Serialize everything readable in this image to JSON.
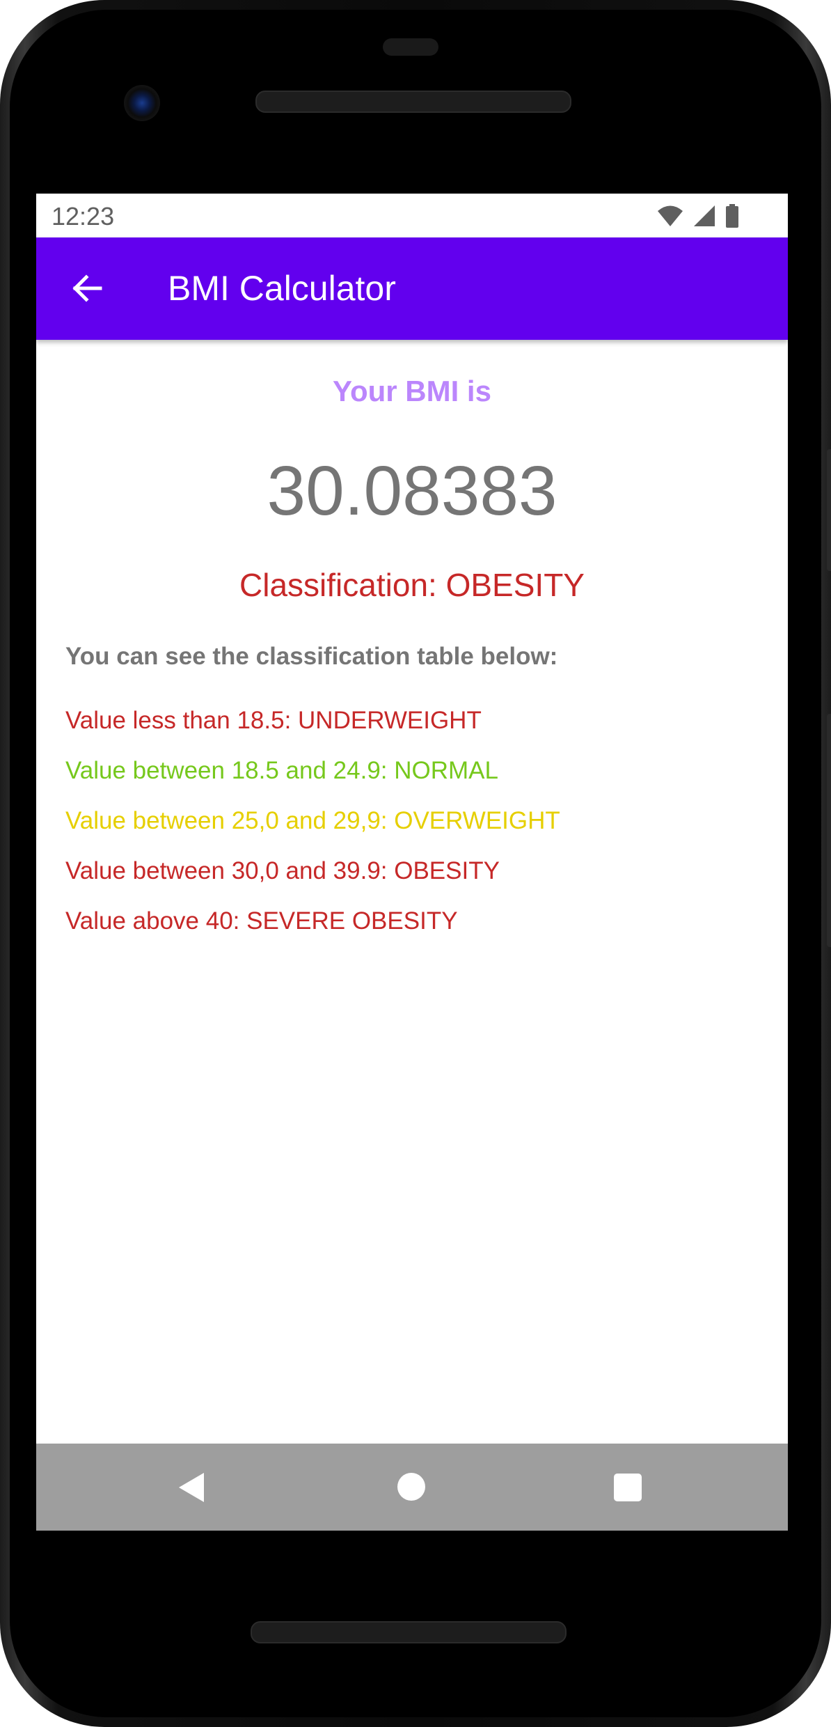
{
  "status_bar": {
    "time": "12:23",
    "icons": [
      "wifi-icon",
      "cellular-signal-icon",
      "battery-icon"
    ]
  },
  "app_bar": {
    "back_icon": "arrow-back-icon",
    "title": "BMI Calculator"
  },
  "result": {
    "heading": "Your BMI is",
    "value": "30.08383",
    "classification": "Classification: OBESITY"
  },
  "table": {
    "intro": "You can see the classification table below:",
    "rows": [
      {
        "text": "Value less than 18.5: UNDERWEIGHT",
        "color": "#c62828"
      },
      {
        "text": "Value between 18.5 and 24.9: NORMAL",
        "color": "#76c81c"
      },
      {
        "text": "Value between 25,0 and 29,9: OVERWEIGHT",
        "color": "#e6cf00"
      },
      {
        "text": "Value between 30,0 and 39.9: OBESITY",
        "color": "#c62828"
      },
      {
        "text": "Value above 40: SEVERE OBESITY",
        "color": "#c62828"
      }
    ]
  },
  "nav_bar": {
    "icons": [
      "nav-back-icon",
      "nav-home-icon",
      "nav-recents-icon"
    ]
  },
  "colors": {
    "app_bar": "#6200ee",
    "heading": "#bb86fc",
    "value": "#757575",
    "classification": "#c62828",
    "nav_bar": "#9e9e9e"
  }
}
